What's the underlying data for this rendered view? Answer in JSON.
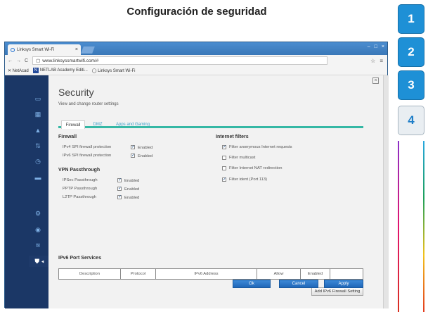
{
  "page_title": "Configuración de seguridad",
  "steps": [
    "1",
    "2",
    "3",
    "4"
  ],
  "active_step": "4",
  "browser": {
    "tab_label": "Linksys Smart Wi-Fi",
    "tab_close": "×",
    "window_buttons": [
      "–",
      "□",
      "×"
    ],
    "url": "www.linksyssmartwifi.com/#",
    "nav": [
      "←",
      "→",
      "C"
    ],
    "bookmarks": [
      "NetAcad",
      "NETLAB Academy Editi...",
      "Linksys Smart Wi-Fi"
    ]
  },
  "security": {
    "title": "Security",
    "subtitle": "View and change router settings",
    "tabs": [
      "Firewall",
      "DMZ",
      "Apps and Gaming"
    ],
    "firewall": {
      "heading": "Firewall",
      "rows": [
        {
          "label": "IPv4 SPI firewall protection",
          "value": "Enabled"
        },
        {
          "label": "IPv6 SPI firewall protection",
          "value": "Enabled"
        }
      ]
    },
    "vpn": {
      "heading": "VPN Passthrough",
      "rows": [
        {
          "label": "IPSec Passthrough",
          "value": "Enabled"
        },
        {
          "label": "PPTP Passthrough",
          "value": "Enabled"
        },
        {
          "label": "L2TP Passthrough",
          "value": "Enabled"
        }
      ]
    },
    "internet_filters": {
      "heading": "Internet filters",
      "items": [
        {
          "label": "Filter anonymous Internet requests",
          "checked": true
        },
        {
          "label": "Filter multicast",
          "checked": false
        },
        {
          "label": "Filter Internet NAT redirection",
          "checked": false
        },
        {
          "label": "Filter ident (Port 113)",
          "checked": true
        }
      ]
    },
    "ipv6_port_services": {
      "heading": "IPv6 Port Services",
      "columns": [
        "Description",
        "Protocol",
        "IPv6 Address",
        "Allow",
        "Enabled",
        ""
      ],
      "add_button": "Add IPv6 Firewall Setting"
    },
    "buttons": {
      "ok": "Ok",
      "cancel": "Cancel",
      "apply": "Apply"
    }
  },
  "colors": {
    "step_blue": "#1e90d6",
    "teal_tab_underline": "#35b8a5",
    "button_blue": "#2a74c6",
    "sidebar_dark": "#1b3766"
  }
}
